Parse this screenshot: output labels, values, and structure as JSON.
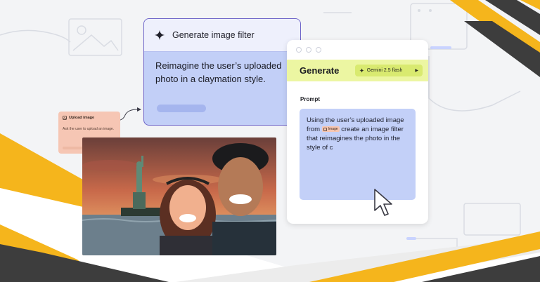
{
  "upload_node": {
    "title": "Upload image",
    "description": "Ask the user to upload an image."
  },
  "filter_card": {
    "title": "Generate image filter",
    "body": "Reimagine the user’s uploaded photo in a claymation style."
  },
  "generate_window": {
    "title": "Generate",
    "model": "Gemini 2.5 flash",
    "prompt_label": "Prompt",
    "prompt_part1": "Using the user’s uploaded image from",
    "chip_label": "Image",
    "prompt_part2": "create an image filter that reimagines the photo in the style of c"
  },
  "icons": [
    "sparkle-icon",
    "image-node-icon",
    "play-icon",
    "mouse-pointer-icon"
  ],
  "colors": {
    "accent_purple": "#6f65c9",
    "card_blue": "#c2cff7",
    "generate_yellow": "#ecf6a2",
    "upload_peach": "#f6c6b4",
    "brand_yellow": "#f5b51c",
    "brand_dark": "#3a3a3a"
  }
}
